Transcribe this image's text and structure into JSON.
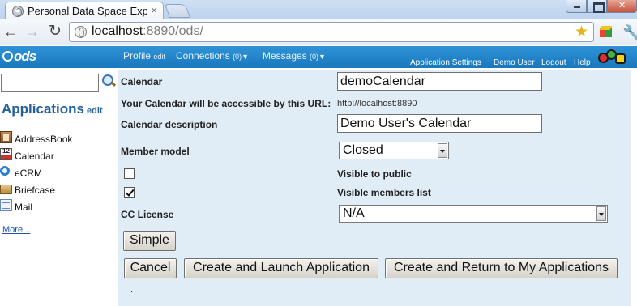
{
  "browser": {
    "tab_title": "Personal Data Space Expl",
    "tab_close": "×",
    "url_host": "localhost",
    "url_rest": ":8890/ods/",
    "icons": {
      "back": "arrow-left",
      "forward": "arrow-right",
      "reload": "refresh",
      "star": "star",
      "extension": "cube",
      "wrench": "wrench"
    }
  },
  "ods_bar": {
    "logo": "ods",
    "nav": {
      "profile": "Profile",
      "profile_edit": "edit",
      "connections": "Connections",
      "connections_count": "(0)",
      "messages": "Messages",
      "messages_count": "(0)",
      "dropdown_glyph": "▼"
    },
    "links": {
      "app_settings": "Application Settings",
      "demo_user": "Demo User",
      "logout": "Logout",
      "help": "Help"
    }
  },
  "sidebar": {
    "search_value": "",
    "heading": "Applications",
    "heading_edit": "edit",
    "items": [
      {
        "label": "AddressBook",
        "icon": "address-book-icon"
      },
      {
        "label": "Calendar",
        "icon": "calendar-icon"
      },
      {
        "label": "eCRM",
        "icon": "crm-icon"
      },
      {
        "label": "Briefcase",
        "icon": "briefcase-icon"
      },
      {
        "label": "Mail",
        "icon": "mail-icon"
      }
    ],
    "more": "More..."
  },
  "form": {
    "calendar_label": "Calendar",
    "calendar_value": "demoCalendar",
    "url_label": "Your Calendar will be accessible by this URL:",
    "url_value": "http://localhost:8890",
    "desc_label": "Calendar description",
    "desc_value": "Demo User's Calendar",
    "member_label": "Member model",
    "member_value": "Closed",
    "public_label": "Visible to public",
    "public_checked": false,
    "members_label": "Visible members list",
    "members_checked": true,
    "cc_label": "CC License",
    "cc_value": "N/A",
    "dot": "."
  },
  "buttons": {
    "simple": "Simple",
    "cancel": "Cancel",
    "launch": "Create and Launch Application",
    "return": "Create and Return to My Applications"
  },
  "colors": {
    "ods_bar": "#1f83c9",
    "panel_bg": "#e1edf6",
    "heading_blue": "#1f5f9c"
  }
}
